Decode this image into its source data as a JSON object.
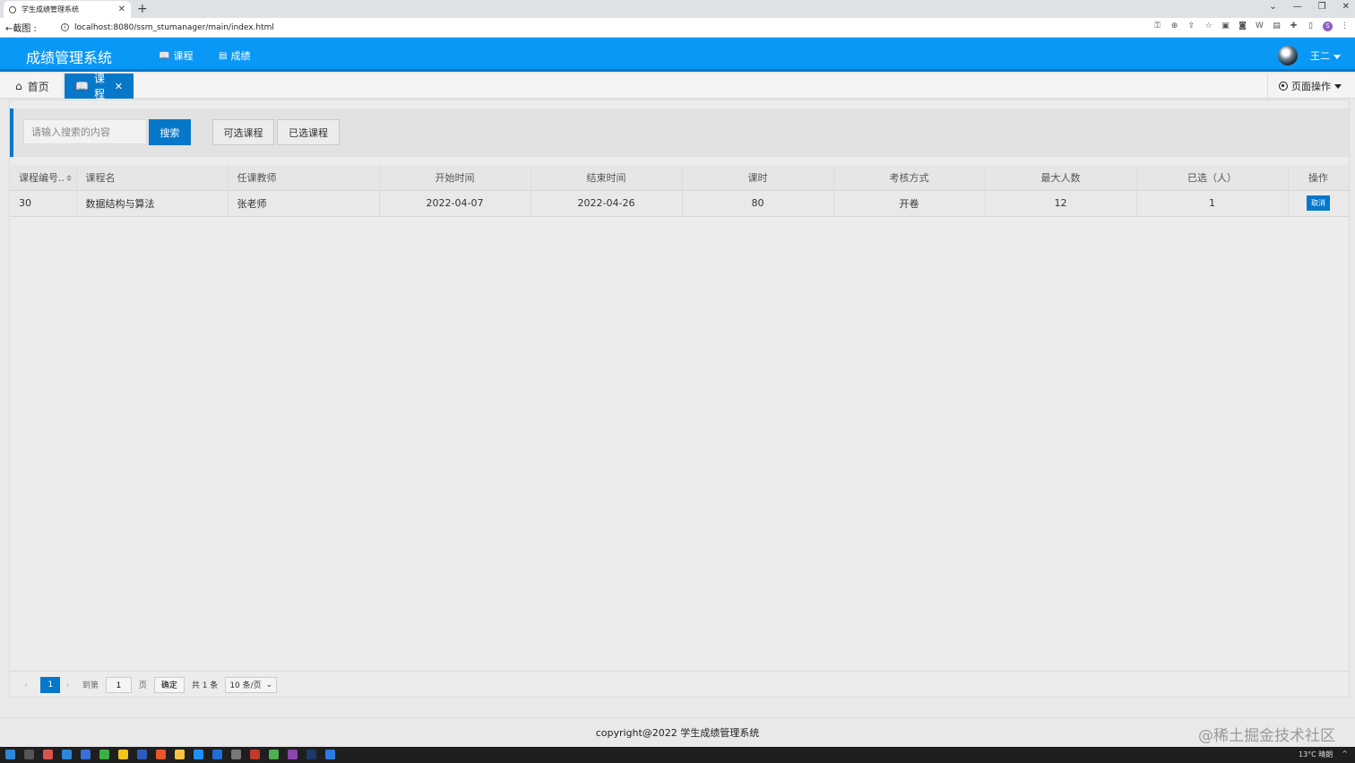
{
  "browser": {
    "tab_title": "学生成绩管理系统",
    "back_label": "←截图 :",
    "url": "localhost:8080/ssm_stumanager/main/index.html",
    "profile_initial": "S"
  },
  "app": {
    "brand": "成绩管理系统",
    "nav": [
      {
        "icon": "book-icon",
        "label": "课程"
      },
      {
        "icon": "document-icon",
        "label": "成绩"
      }
    ],
    "user": "王二",
    "accent_color": "#0a98f6",
    "dark_accent": "#0677c9"
  },
  "tabs": {
    "home": "首页",
    "active": "课程",
    "page_ops": "页面操作"
  },
  "search": {
    "placeholder": "请输入搜索的内容",
    "button": "搜索",
    "available": "可选课程",
    "selected": "已选课程"
  },
  "table": {
    "headers": [
      "课程编号..",
      "课程名",
      "任课教师",
      "开始时间",
      "结束时间",
      "课时",
      "考核方式",
      "最大人数",
      "已选（人）",
      "操作"
    ],
    "rows": [
      {
        "id": "30",
        "name": "数据结构与算法",
        "teacher": "张老师",
        "start": "2022-04-07",
        "end": "2022-04-26",
        "hours": "80",
        "exam": "开卷",
        "max": "12",
        "chosen": "1",
        "action": "取消"
      }
    ]
  },
  "pager": {
    "current": "1",
    "goto": "到第",
    "page_value": "1",
    "page_unit": "页",
    "ok": "确定",
    "total": "共 1 条",
    "size": "10 条/页"
  },
  "footer": "copyright@2022 学生成绩管理系统",
  "watermark": "@稀土掘金技术社区",
  "taskbar": {
    "weather": "13°C 晴朗"
  }
}
